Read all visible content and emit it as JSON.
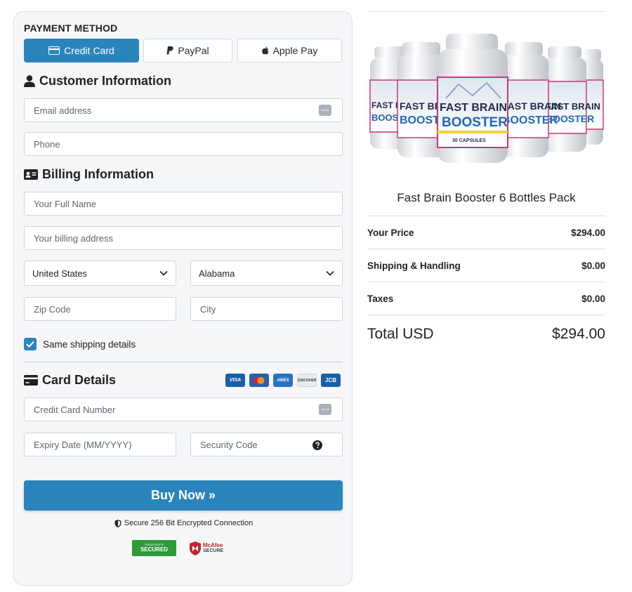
{
  "payment": {
    "method_label": "PAYMENT METHOD",
    "tabs": [
      {
        "label": "Credit Card",
        "icon": "credit-card-icon",
        "active": true
      },
      {
        "label": "PayPal",
        "icon": "paypal-icon",
        "active": false
      },
      {
        "label": "Apple Pay",
        "icon": "apple-icon",
        "active": false
      }
    ]
  },
  "customer": {
    "title": "Customer Information",
    "email_placeholder": "Email address",
    "phone_placeholder": "Phone"
  },
  "billing": {
    "title": "Billing Information",
    "name_placeholder": "Your Full Name",
    "address_placeholder": "Your billing address",
    "country": "United States",
    "state": "Alabama",
    "zip_placeholder": "Zip Code",
    "city_placeholder": "City",
    "same_shipping_label": "Same shipping details",
    "same_shipping_checked": true
  },
  "card": {
    "title": "Card Details",
    "brands": [
      "VISA",
      "MC",
      "AMEX",
      "DISCOVER",
      "JCB"
    ],
    "number_placeholder": "Credit Card Number",
    "expiry_placeholder": "Expiry Date (MM/YYYY)",
    "cvv_placeholder": "Security Code"
  },
  "buy_button": "Buy Now »",
  "secure_text": "Secure 256 Bit Encrypted Connection",
  "badges": {
    "trustedsite_top": "TRUSTEDSITE",
    "trustedsite_main": "SECURED",
    "mcafee_top": "McAfee",
    "mcafee_bottom": "SECURE"
  },
  "product": {
    "bottle_brand_line1": "FAST BRAIN",
    "bottle_brand_line2": "BOOSTER",
    "bottle_caption": "30 CAPSULES",
    "name": "Fast Brain Booster 6 Bottles Pack"
  },
  "summary": {
    "rows": [
      {
        "label": "Your Price",
        "value": "$294.00"
      },
      {
        "label": "Shipping & Handling",
        "value": "$0.00"
      },
      {
        "label": "Taxes",
        "value": "$0.00"
      }
    ],
    "total_label": "Total USD",
    "total_value": "$294.00"
  },
  "colors": {
    "accent": "#2b85bd",
    "panel_bg": "#f5f7f9",
    "check": "#2b85bd"
  }
}
